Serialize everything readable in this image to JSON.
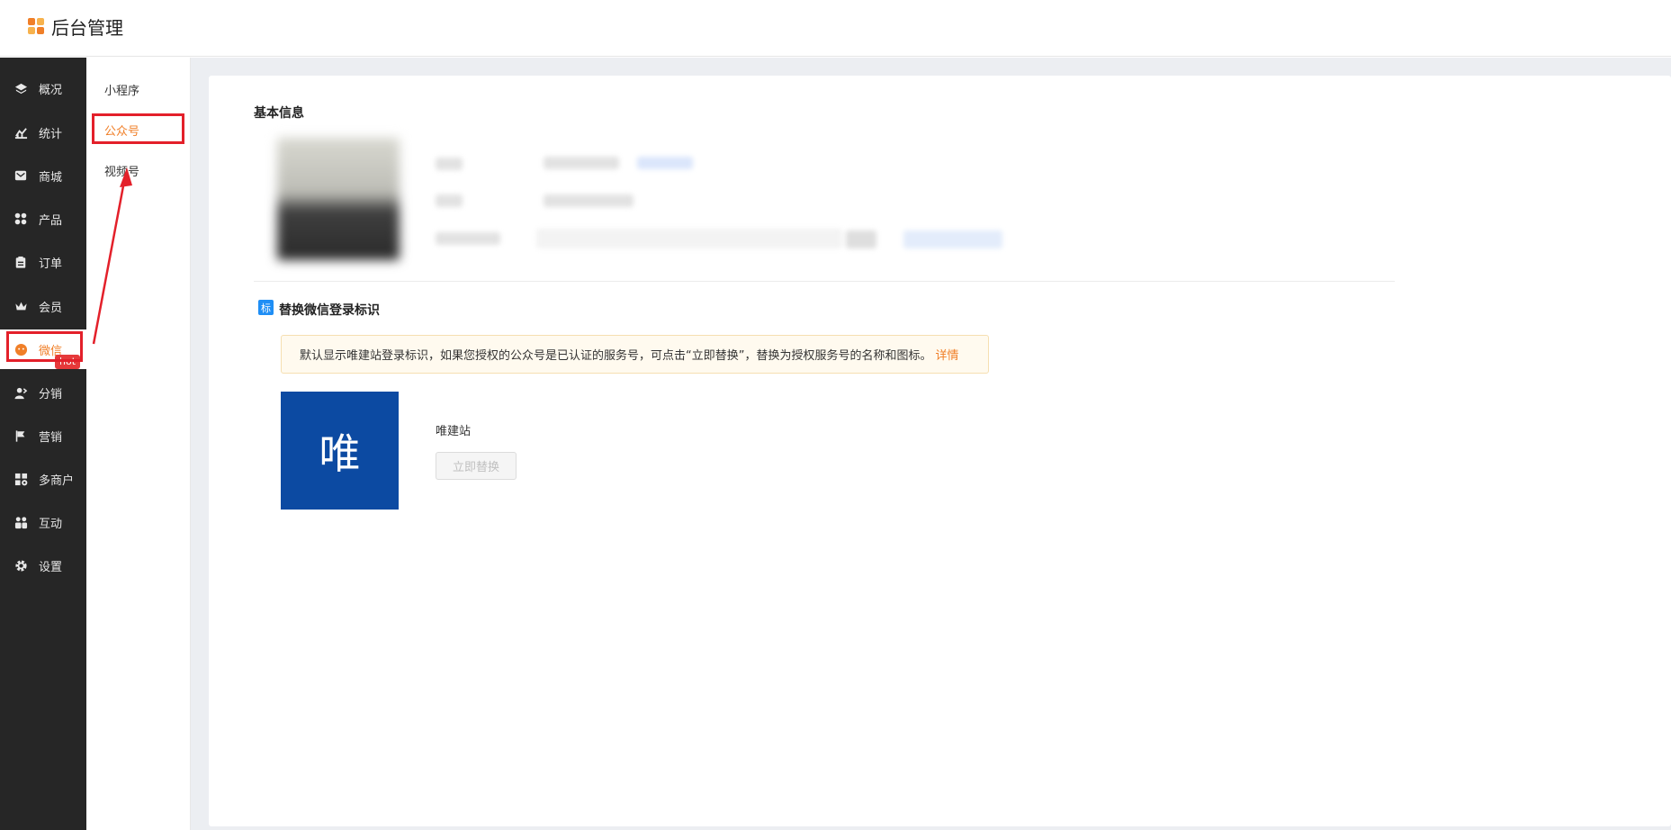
{
  "app": {
    "title": "后台管理"
  },
  "sidebar": {
    "items": [
      {
        "label": "概况",
        "icon": "layers-icon"
      },
      {
        "label": "统计",
        "icon": "chart-icon"
      },
      {
        "label": "商城",
        "icon": "mail-icon"
      },
      {
        "label": "产品",
        "icon": "grid-icon"
      },
      {
        "label": "订单",
        "icon": "order-icon"
      },
      {
        "label": "会员",
        "icon": "crown-icon"
      },
      {
        "label": "微信",
        "icon": "wechat-icon"
      },
      {
        "label": "分销",
        "icon": "users-icon"
      },
      {
        "label": "营销",
        "icon": "flag-icon"
      },
      {
        "label": "多商户",
        "icon": "store-icon"
      },
      {
        "label": "互动",
        "icon": "group-icon"
      },
      {
        "label": "设置",
        "icon": "gear-icon"
      }
    ],
    "active": "微信",
    "hot_badge": "hot"
  },
  "subnav": {
    "items": [
      {
        "label": "小程序"
      },
      {
        "label": "公众号"
      },
      {
        "label": "视频号"
      }
    ],
    "active": "公众号"
  },
  "basic_info": {
    "title": "基本信息"
  },
  "login_mark": {
    "icon_text": "标",
    "title": "替换微信登录标识",
    "notice": "默认显示唯建站登录标识，如果您授权的公众号是已认证的服务号，可点击“立即替换”，替换为授权服务号的名称和图标。",
    "notice_link": "详情",
    "brand_char": "唯",
    "site_name": "唯建站",
    "replace_button": "立即替换"
  },
  "colors": {
    "accent": "#f07f28",
    "sidebar_bg": "#262626",
    "highlight": "#e3202a",
    "brand_tile": "#0c4aa2",
    "hot": "#e6393a"
  }
}
